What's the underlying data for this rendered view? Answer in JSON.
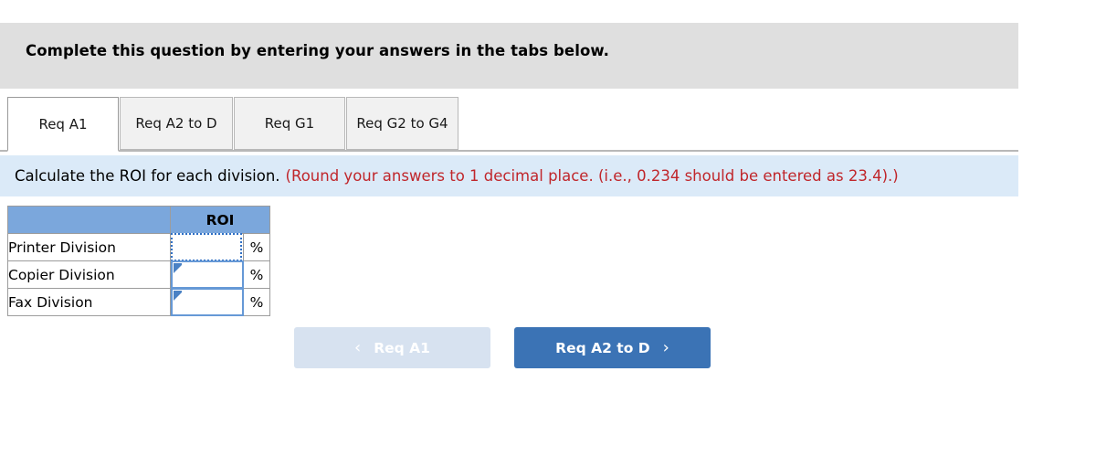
{
  "banner": {
    "title": "Complete this question by entering your answers in the tabs below."
  },
  "tabs": [
    {
      "label": "Req A1",
      "active": true
    },
    {
      "label": "Req A2 to D",
      "active": false
    },
    {
      "label": "Req G1",
      "active": false
    },
    {
      "label": "Req G2 to G4",
      "active": false
    }
  ],
  "requirement": {
    "prompt": "Calculate the ROI for each division.",
    "hint": "(Round your answers to 1 decimal place. (i.e., 0.234 should be entered as 23.4).)"
  },
  "table": {
    "blank_header": "",
    "value_header": "ROI",
    "percent_symbol": "%",
    "rows": [
      {
        "label": "Printer Division",
        "value": "",
        "unit": "%"
      },
      {
        "label": "Copier Division",
        "value": "",
        "unit": "%"
      },
      {
        "label": "Fax Division",
        "value": "",
        "unit": "%"
      }
    ]
  },
  "navigation": {
    "prev_label": "Req A1",
    "next_label": "Req A2 to D",
    "prev_icon": "chevron-left-icon",
    "next_icon": "chevron-right-icon",
    "prev_chevron": "‹",
    "next_chevron": "›"
  },
  "colors": {
    "banner_grey": "#dfdfdf",
    "requirement_blue": "#dbeaf8",
    "table_header_blue": "#7ba7dc",
    "hint_red": "#c0262b",
    "next_button_blue": "#3b73b5",
    "prev_button_blue": "#d7e2f0",
    "input_focus_blue": "#2f6fc4"
  }
}
